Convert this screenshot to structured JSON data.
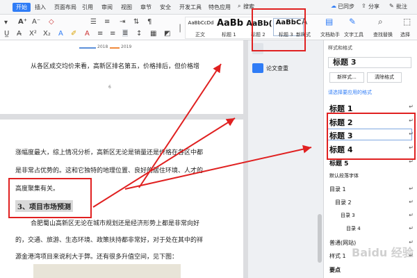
{
  "menu": {
    "tabs": [
      "开始",
      "插入",
      "页面布局",
      "引用",
      "审阅",
      "视图",
      "章节",
      "安全",
      "开发工具",
      "特色应用"
    ],
    "search_label": "搜索",
    "sync_label": "已同步",
    "share_label": "分享",
    "annotate_label": "批注"
  },
  "ribbon": {
    "style_samples": [
      {
        "sample": "AaBbCcDd",
        "label": "正文"
      },
      {
        "sample": "AaBb",
        "label": "标题 1"
      },
      {
        "sample": "AaBb(",
        "label": "标题 2"
      },
      {
        "sample": "AaBbC",
        "label": "标题 3"
      }
    ],
    "new_style_label": "新样式",
    "doc_helper_label": "文档助手",
    "text_tools_label": "文字工具",
    "find_replace_label": "查找替换",
    "select_label": "选择"
  },
  "doc": {
    "legend": [
      "2018",
      "2019"
    ],
    "line_top": "从各区成交均价来看，高新区排名第五，价格排后，但价格增",
    "page_number": "6",
    "lines": [
      "涨幅度最大，综上情况分析，高新区无论是销量还是价格在各区中都",
      "是非常占优势的。这和它独特的地理位置、良好的居住环境、人才的",
      "高度聚集有关。"
    ],
    "heading": "3、项目市场预测",
    "para2": [
      "合肥蜀山高新区无论在城市规划还是经济形势上都是非常向好",
      "的，交通、旅游、生态环境、政策扶持都非常好，对于处在其中的祥",
      "源金港湾项目来说利大于弊。还有很多升值空间，见下图："
    ]
  },
  "mid": {
    "check_label": "论文查重"
  },
  "panel": {
    "header": "样式和格式",
    "current_style": "标题 3",
    "new_style_button": "新样式...",
    "clear_format_button": "清除格式",
    "apply_prompt": "请选择要应用的格式",
    "styles": [
      "标题 1",
      "标题 2",
      "标题 3",
      "标题 4",
      "标题 5",
      "默认段落字体",
      "目录 1",
      "目录 2",
      "目录 3",
      "目录 4",
      "普通(网站)",
      "样式 1",
      "要点"
    ]
  },
  "watermark": "Baidu 经验",
  "colors": {
    "accent": "#2f7cf6",
    "red": "#e02020"
  }
}
